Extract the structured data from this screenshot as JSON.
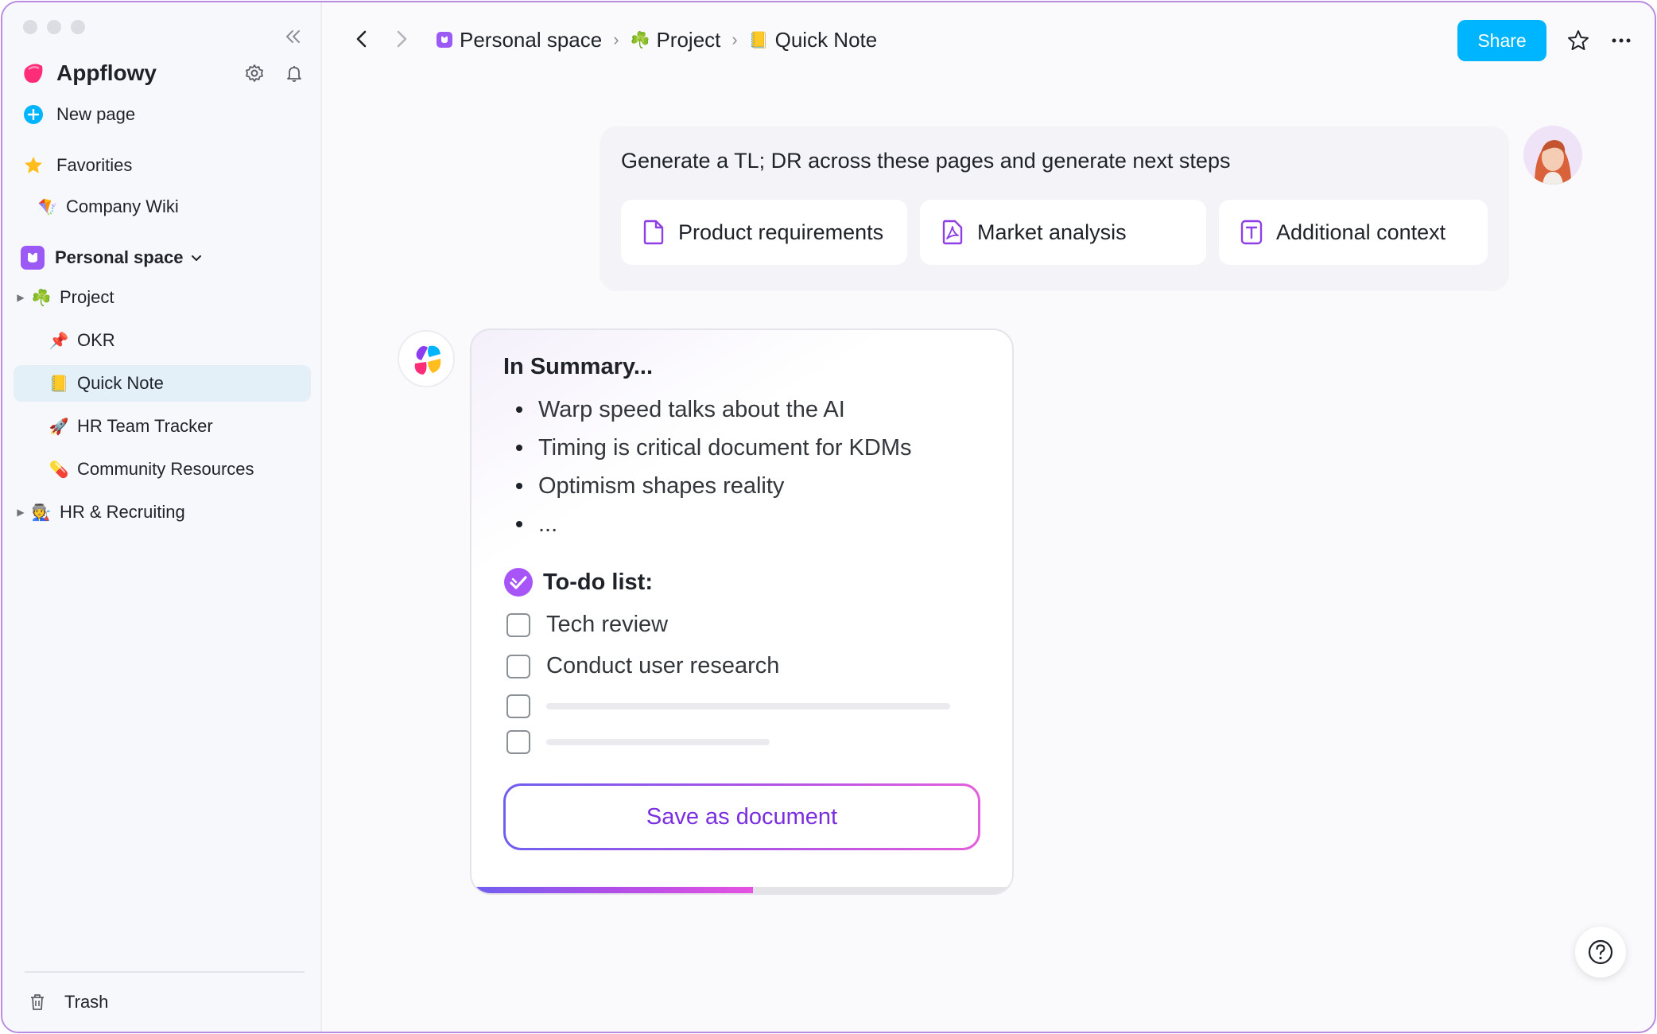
{
  "sidebar": {
    "app_name": "Appflowy",
    "new_page_label": "New page",
    "favorites_label": "Favorities",
    "favorites": [
      {
        "emoji": "🪁",
        "label": "Company Wiki"
      }
    ],
    "space_name": "Personal space",
    "tree": [
      {
        "emoji": "☘️",
        "label": "Project"
      },
      {
        "emoji": "📌",
        "label": "OKR"
      },
      {
        "emoji": "📒",
        "label": "Quick Note",
        "active": true
      },
      {
        "emoji": "🚀",
        "label": "HR Team Tracker"
      },
      {
        "emoji": "💊",
        "label": "Community Resources"
      },
      {
        "emoji": "🧑‍🏭",
        "label": "HR & Recruiting"
      }
    ],
    "trash_label": "Trash"
  },
  "topbar": {
    "breadcrumbs": [
      {
        "icon": "space-icon",
        "label": "Personal space"
      },
      {
        "emoji": "☘️",
        "label": "Project"
      },
      {
        "emoji": "📒",
        "label": "Quick Note"
      }
    ],
    "separator": "›",
    "share_label": "Share"
  },
  "prompt": {
    "text": "Generate a TL; DR across these pages and generate next steps",
    "attachments": [
      {
        "icon": "document-icon",
        "label": "Product requirements"
      },
      {
        "icon": "pdf-icon",
        "label": "Market analysis"
      },
      {
        "icon": "text-icon",
        "label": "Additional context"
      }
    ]
  },
  "response": {
    "title": "In Summary...",
    "bullets": [
      "Warp speed talks about the AI",
      "Timing is critical document for KDMs",
      "Optimism shapes reality",
      "..."
    ],
    "todo_title": "To-do list:",
    "todos": [
      {
        "label": "Tech review",
        "checked": false
      },
      {
        "label": "Conduct user research",
        "checked": false
      },
      {
        "label": "",
        "checked": false
      },
      {
        "label": "",
        "checked": false
      }
    ],
    "save_label": "Save as document",
    "progress": 0.52
  },
  "colors": {
    "accent": "#00b5ff",
    "brand_purple": "#9b59f5",
    "active_row": "#e3f0f8",
    "window_border": "#b98be0"
  }
}
